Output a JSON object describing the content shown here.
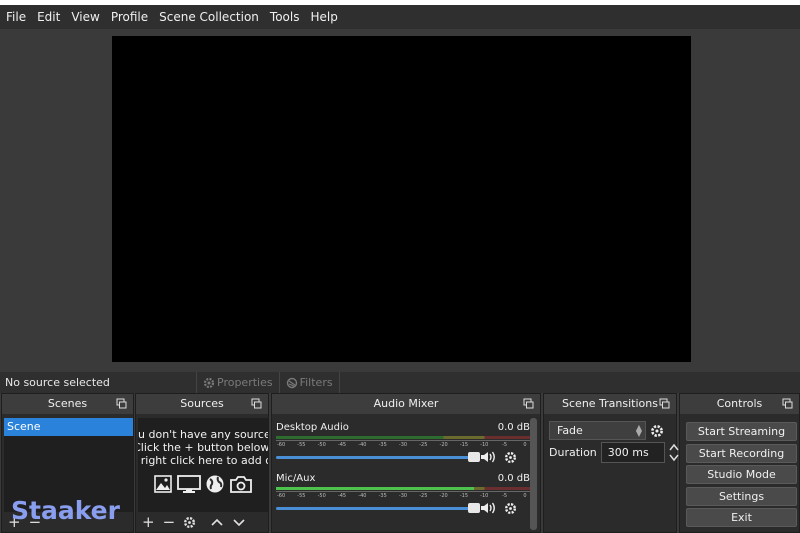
{
  "menu": [
    "File",
    "Edit",
    "View",
    "Profile",
    "Scene Collection",
    "Tools",
    "Help"
  ],
  "status": {
    "no_source": "No source selected",
    "properties": "Properties",
    "filters": "Filters"
  },
  "scenes": {
    "title": "Scenes",
    "items": [
      "Scene"
    ]
  },
  "sources": {
    "title": "Sources",
    "empty_line1": "You don't have any sources.",
    "empty_line2": "Click the + button below,",
    "empty_line3": "or right click here to add one."
  },
  "mixer": {
    "title": "Audio Mixer",
    "ticks": [
      "-60",
      "-55",
      "-50",
      "-45",
      "-40",
      "-35",
      "-30",
      "-25",
      "-20",
      "-15",
      "-10",
      "-5",
      "0"
    ],
    "channels": [
      {
        "name": "Desktop Audio",
        "db": "0.0 dB",
        "level": 0.0,
        "volume": 1.0
      },
      {
        "name": "Mic/Aux",
        "db": "0.0 dB",
        "level": 0.78,
        "volume": 1.0
      }
    ]
  },
  "transitions": {
    "title": "Scene Transitions",
    "selected": "Fade",
    "duration_label": "Duration",
    "duration_value": "300 ms"
  },
  "controls": {
    "title": "Controls",
    "buttons": [
      "Start Streaming",
      "Start Recording",
      "Studio Mode",
      "Settings",
      "Exit"
    ]
  },
  "watermark": "Staaker",
  "colors": {
    "accent": "#2a82da",
    "preview_bg": "#000000",
    "panel_bg": "#2b2b2b"
  }
}
